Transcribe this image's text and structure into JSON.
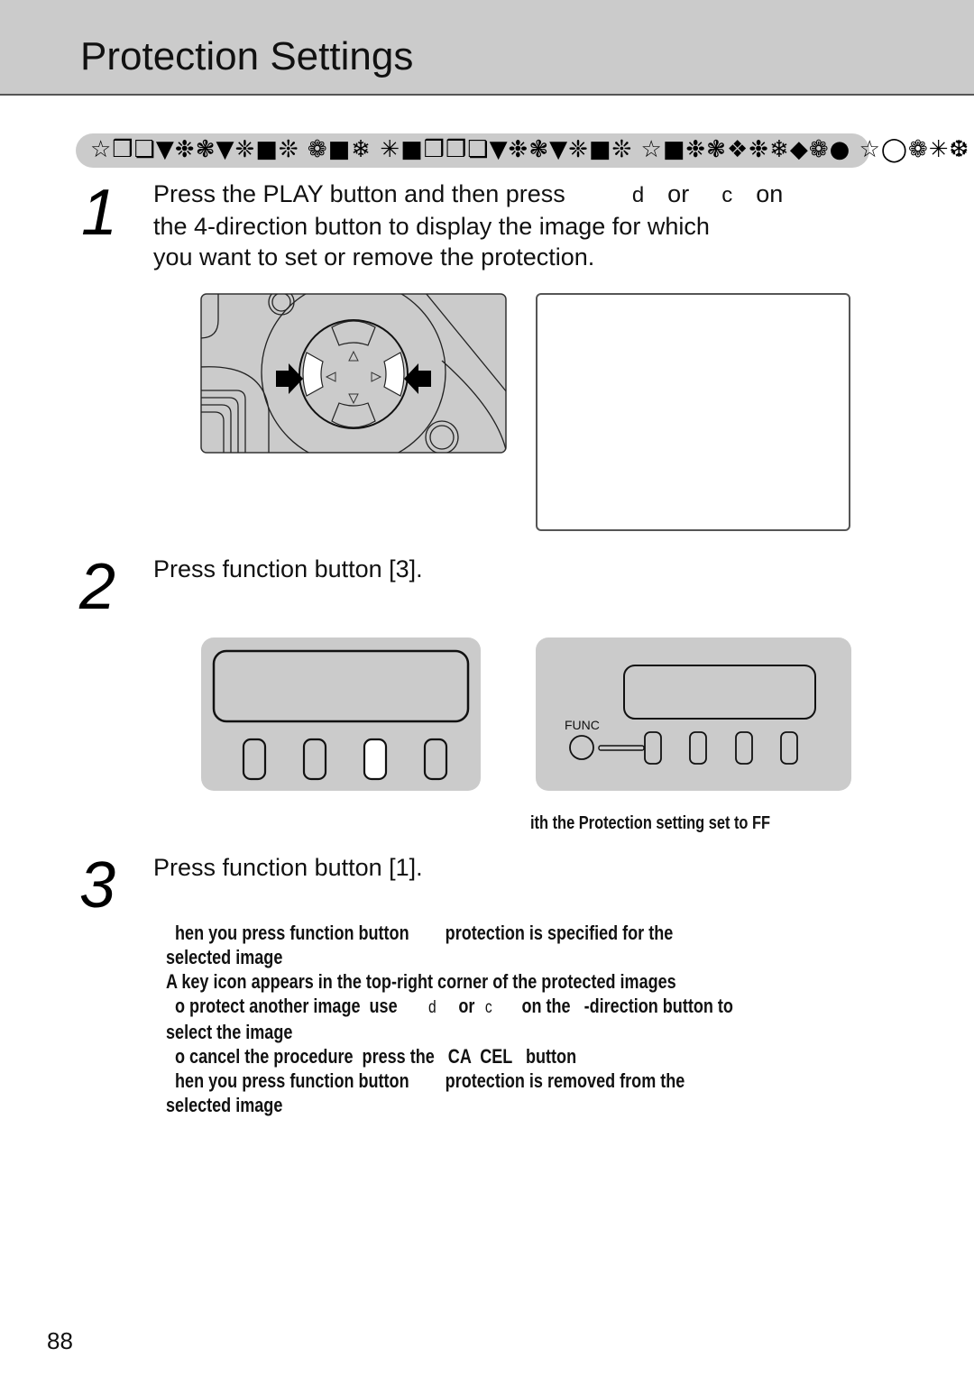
{
  "header": {
    "title": "Protection Settings"
  },
  "section_heading": {
    "glyphs": "☆❒❏▼❉❃▼❈■❊ ❁■❄ ✳■❒❒❏▼❉❃▼❈■❊ ☆■❉❃❖❉❄◆❁● ☆◯❁✳❆"
  },
  "steps": [
    {
      "number": "1",
      "lines": [
        {
          "parts": [
            "Press the  PLAY  button and then press",
            "d",
            "or",
            "c",
            "on"
          ]
        },
        {
          "text": "the 4-direction button to display the image for which"
        },
        {
          "text": "you want to set or remove the protection."
        }
      ]
    },
    {
      "number": "2",
      "text": "Press function button [3]."
    },
    {
      "number": "3",
      "text": "Press function button [1]."
    }
  ],
  "figures": {
    "dpad": {
      "arrows": [
        "△",
        "◁",
        "▷",
        "▽"
      ]
    },
    "panel_right": {
      "func_label": "FUNC"
    },
    "caption": "ith the Protection setting set to     FF"
  },
  "notes": [
    {
      "text": "  hen you press function button        protection is specified for the"
    },
    {
      "text": "selected image"
    },
    {
      "text": "A key icon appears in the top-right corner of the protected images"
    },
    {
      "parts": [
        "  o protect another image  use",
        "d",
        "or",
        "c",
        "on the   -direction button to"
      ]
    },
    {
      "text": "select the image"
    },
    {
      "text": "  o cancel the procedure  press the   CA  CEL   button"
    },
    {
      "text": "  hen you press function button        protection is removed from the"
    },
    {
      "text": "selected image"
    }
  ],
  "page_number": "88"
}
